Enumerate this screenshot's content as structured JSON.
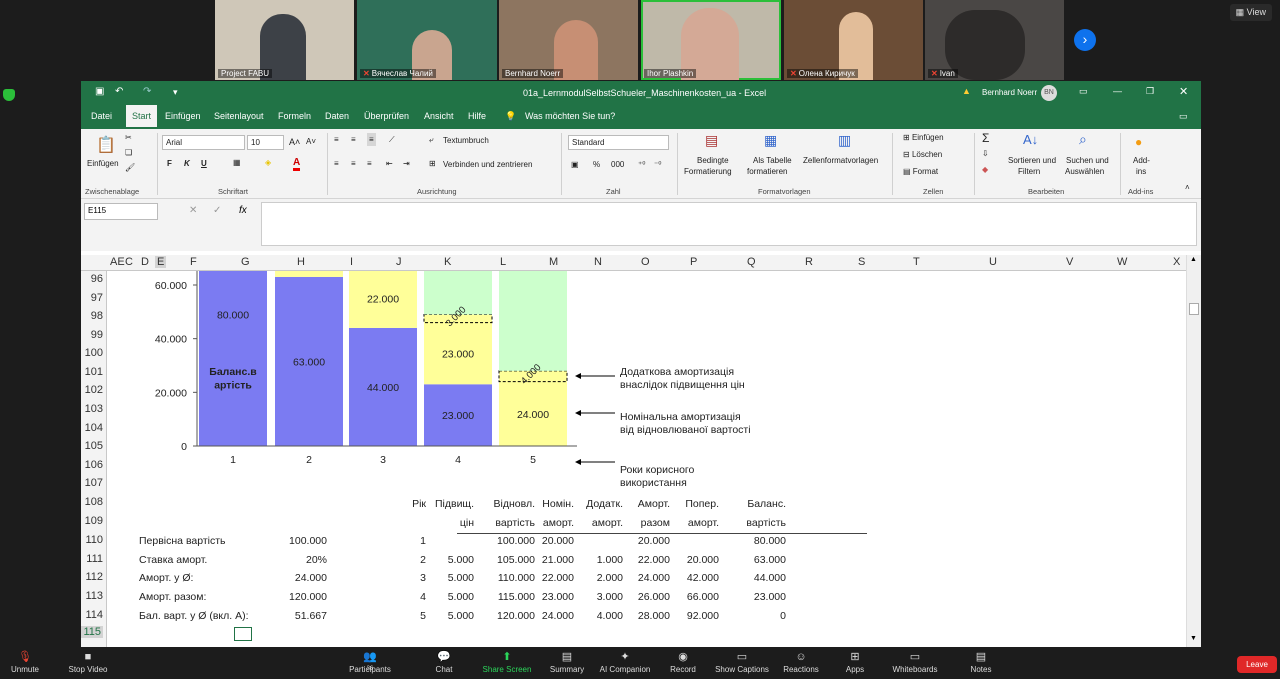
{
  "zoom": {
    "view_label": "View",
    "participants_tiles": [
      {
        "name": "Project FABU",
        "muted": false
      },
      {
        "name": "Вячеслав Чалий",
        "muted": true
      },
      {
        "name": "Bernhard Noerr",
        "muted": false
      },
      {
        "name": "Ihor Plashkin",
        "muted": false
      },
      {
        "name": "Олена Киричук",
        "muted": true
      },
      {
        "name": "Ivan",
        "muted": true
      }
    ],
    "toolbar": {
      "unmute": "Unmute",
      "stop_video": "Stop Video",
      "participants": "Participants",
      "participants_count": "36",
      "chat": "Chat",
      "share_screen": "Share Screen",
      "summary": "Summary",
      "ai_companion": "AI Companion",
      "record": "Record",
      "show_captions": "Show Captions",
      "reactions": "Reactions",
      "apps": "Apps",
      "whiteboards": "Whiteboards",
      "notes": "Notes",
      "leave": "Leave"
    }
  },
  "excel": {
    "title": "01a_LernmodulSelbstSchueler_Maschinenkosten_ua  -  Excel",
    "user": "Bernhard Noerr",
    "user_initials": "BN",
    "tabs": [
      "Datei",
      "Start",
      "Einfügen",
      "Seitenlayout",
      "Formeln",
      "Daten",
      "Überprüfen",
      "Ansicht",
      "Hilfe"
    ],
    "active_tab": "Start",
    "tell_me": "Was möchten Sie tun?",
    "ribbon": {
      "paste": "Einfügen",
      "clipboard": "Zwischenablage",
      "font_name": "Arial",
      "font_size": "10",
      "font_group": "Schriftart",
      "bold": "F",
      "italic": "K",
      "underline": "U",
      "wrap_text": "Textumbruch",
      "merge_center": "Verbinden und zentrieren",
      "alignment": "Ausrichtung",
      "number_format": "Standard",
      "number_group": "Zahl",
      "cond_format_1": "Bedingte",
      "cond_format_2": "Formatierung",
      "as_table_1": "Als Tabelle",
      "as_table_2": "formatieren",
      "cell_styles": "Zellenformatvorlagen",
      "styles_group": "Formatvorlagen",
      "insert_cells": "Einfügen",
      "delete_cells": "Löschen",
      "format_cells": "Format",
      "cells_group": "Zellen",
      "sort_1": "Sortieren und",
      "sort_2": "Filtern",
      "find_1": "Suchen und",
      "find_2": "Auswählen",
      "editing_group": "Bearbeiten",
      "addins_1": "Add-",
      "addins_2": "ins",
      "addins_group": "Add-ins"
    },
    "name_box": "E115",
    "fx": "fx",
    "columns": [
      "AE",
      "C",
      "D",
      "E",
      "F",
      "G",
      "H",
      "I",
      "J",
      "K",
      "L",
      "M",
      "N",
      "O",
      "P",
      "Q",
      "R",
      "S",
      "T",
      "U",
      "V",
      "W",
      "X"
    ],
    "rows": [
      "96",
      "97",
      "98",
      "99",
      "100",
      "101",
      "102",
      "103",
      "104",
      "105",
      "106",
      "107",
      "108",
      "109",
      "110",
      "111",
      "112",
      "113",
      "114",
      "115"
    ]
  },
  "chart_data": {
    "type": "bar",
    "stacked": true,
    "categories": [
      "1",
      "2",
      "3",
      "4",
      "5"
    ],
    "ylim": [
      0,
      60000
    ],
    "yticks": [
      "0",
      "20.000",
      "40.000",
      "60.000"
    ],
    "series": [
      {
        "name": "",
        "color": "#7b7bf2",
        "values": [
          80000,
          63000,
          44000,
          23000,
          0
        ]
      },
      {
        "name": "Номінальна амортизація від відновлюваної вартості",
        "color": "#ffff99",
        "values": [
          20000,
          21000,
          22000,
          23000,
          24000
        ]
      },
      {
        "name": "Додаткова амортизація внаслідок підвищення цін",
        "color": "#ffff99",
        "values": [
          0,
          0,
          0,
          3000,
          4000
        ]
      },
      {
        "name": "",
        "color": "#ccffcc",
        "values": [
          0,
          0,
          0,
          51000,
          92000
        ]
      }
    ],
    "bar_labels": [
      {
        "bar": 0,
        "text": "80.000",
        "y": 49000
      },
      {
        "bar": 0,
        "text": "Баланс.в",
        "y": 28000
      },
      {
        "bar": 0,
        "text": "артість",
        "y": 23000
      },
      {
        "bar": 1,
        "text": "63.000",
        "y": 31500
      },
      {
        "bar": 2,
        "text": "22.000",
        "y": 55000
      },
      {
        "bar": 2,
        "text": "44.000",
        "y": 22000
      },
      {
        "bar": 3,
        "text": "23.000",
        "y": 34500
      },
      {
        "bar": 3,
        "text": "23.000",
        "y": 11500
      },
      {
        "bar": 4,
        "text": "24.000",
        "y": 12000
      }
    ],
    "rotated_labels": [
      {
        "bar": 3,
        "text": "3.000",
        "y": 47500
      },
      {
        "bar": 4,
        "text": "4.000",
        "y": 26000
      }
    ],
    "annotations": {
      "additional_1": "Додаткова амортизація",
      "additional_2": "внаслідок підвищення цін",
      "nominal_1": "Номінальна амортизація",
      "nominal_2": "від відновлюваної вартості",
      "years_1": "Роки корисного",
      "years_2": "використання"
    }
  },
  "params": {
    "labels": [
      "Первісна вартість",
      "Ставка аморт.",
      "Аморт. у Ø:",
      "Аморт. разом:",
      "Бал. варт. у Ø (вкл. А):"
    ],
    "values": [
      "100.000",
      "20%",
      "24.000",
      "120.000",
      "51.667"
    ]
  },
  "table": {
    "headers_1": [
      "Рік",
      "Підвищ.",
      "Відновл.",
      "Номін.",
      "Додатк.",
      "Аморт.",
      "Попер.",
      "Баланс."
    ],
    "headers_2": [
      "",
      "цін",
      "вартість",
      "аморт.",
      "аморт.",
      "разом",
      "аморт.",
      "вартість"
    ],
    "rows": [
      [
        "1",
        "",
        "100.000",
        "20.000",
        "",
        "20.000",
        "",
        "80.000"
      ],
      [
        "2",
        "5.000",
        "105.000",
        "21.000",
        "1.000",
        "22.000",
        "20.000",
        "63.000"
      ],
      [
        "3",
        "5.000",
        "110.000",
        "22.000",
        "2.000",
        "24.000",
        "42.000",
        "44.000"
      ],
      [
        "4",
        "5.000",
        "115.000",
        "23.000",
        "3.000",
        "26.000",
        "66.000",
        "23.000"
      ],
      [
        "5",
        "5.000",
        "120.000",
        "24.000",
        "4.000",
        "28.000",
        "92.000",
        "0"
      ]
    ]
  }
}
